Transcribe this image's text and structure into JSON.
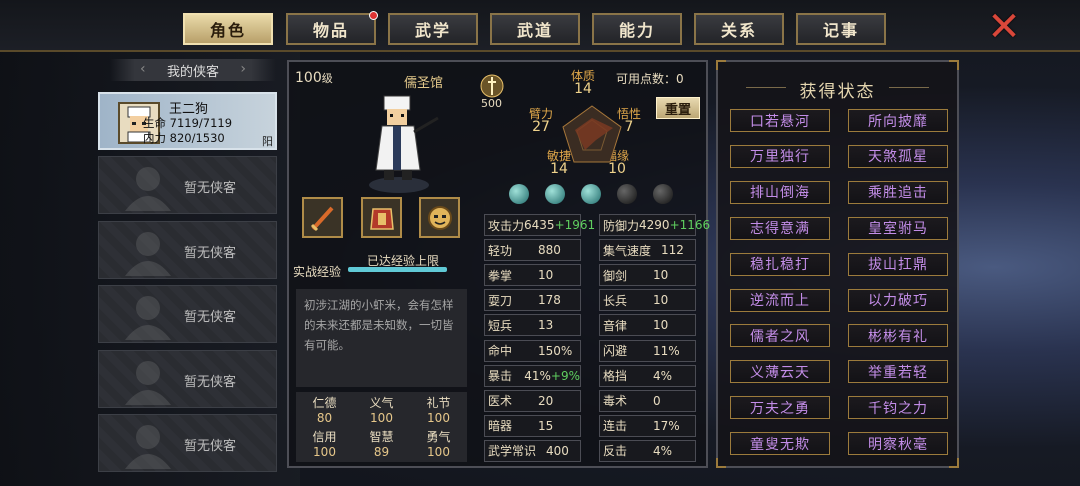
{
  "tabs": [
    {
      "label": "角色",
      "active": true
    },
    {
      "label": "物品",
      "badge": true
    },
    {
      "label": "武学"
    },
    {
      "label": "武道"
    },
    {
      "label": "能力"
    },
    {
      "label": "关系"
    },
    {
      "label": "记事"
    }
  ],
  "left": {
    "header": "我的侠客",
    "selected": {
      "name": "王二狗",
      "hp": "生命 7119/7119",
      "mp": "内力 820/1530",
      "yin_yang": "阳"
    },
    "empty_label": "暂无侠客"
  },
  "center": {
    "level": "100",
    "level_unit": "级",
    "school": "儒圣馆",
    "power_value": "500",
    "points_label": "可用点数：0",
    "reset_label": "重置",
    "exp_label": "实战经验",
    "exp_status": "已达经验上限",
    "exp_fill": 1.0,
    "radar": {
      "tizhi_l": "体质",
      "tizhi_v": "14",
      "bili_l": "臂力",
      "bili_v": "27",
      "xingge_l": "悟性",
      "xingge_v": "7",
      "minjie_l": "敏捷",
      "minjie_v": "14",
      "fuyuan_l": "福缘",
      "fuyuan_v": "10"
    },
    "description": "初涉江湖的小虾米，会有怎样的未来还都是未知数，一切皆有可能。",
    "virtues": [
      {
        "name": "仁德",
        "value": "80"
      },
      {
        "name": "义气",
        "value": "100"
      },
      {
        "name": "礼节",
        "value": "100"
      },
      {
        "name": "信用",
        "value": "100"
      },
      {
        "name": "智慧",
        "value": "89"
      },
      {
        "name": "勇气",
        "value": "100"
      }
    ],
    "stats_left": [
      {
        "label": "攻击力",
        "value": "6435",
        "bonus": "+1961"
      },
      {
        "label": "轻功",
        "value": "880"
      },
      {
        "label": "拳掌",
        "value": "10"
      },
      {
        "label": "耍刀",
        "value": "178"
      },
      {
        "label": "短兵",
        "value": "13"
      },
      {
        "label": "命中",
        "value": "150%"
      },
      {
        "label": "暴击",
        "value": "41%",
        "bonus": "+9%"
      },
      {
        "label": "医术",
        "value": "20"
      },
      {
        "label": "暗器",
        "value": "15"
      },
      {
        "label": "武学常识",
        "value": "400"
      }
    ],
    "stats_right": [
      {
        "label": "防御力",
        "value": "4290",
        "bonus": "+1166"
      },
      {
        "label": "集气速度",
        "value": "112"
      },
      {
        "label": "御剑",
        "value": "10"
      },
      {
        "label": "长兵",
        "value": "10"
      },
      {
        "label": "音律",
        "value": "10"
      },
      {
        "label": "闪避",
        "value": "11%"
      },
      {
        "label": "格挡",
        "value": "4%"
      },
      {
        "label": "毒术",
        "value": "0"
      },
      {
        "label": "连击",
        "value": "17%"
      },
      {
        "label": "反击",
        "value": "4%"
      }
    ]
  },
  "right": {
    "title": "获得状态",
    "statuses": [
      "口若悬河",
      "所向披靡",
      "万里独行",
      "天煞孤星",
      "排山倒海",
      "乘胜追击",
      "志得意满",
      "皇室驸马",
      "稳扎稳打",
      "拔山扛鼎",
      "逆流而上",
      "以力破巧",
      "儒者之风",
      "彬彬有礼",
      "义薄云天",
      "举重若轻",
      "万夫之勇",
      "千钧之力",
      "童叟无欺",
      "明察秋毫"
    ]
  },
  "colors": {
    "accent": "#c38de8",
    "gold": "#b08c48",
    "exp_bar": "#60c9d6",
    "bonus": "#5fcf5f"
  }
}
